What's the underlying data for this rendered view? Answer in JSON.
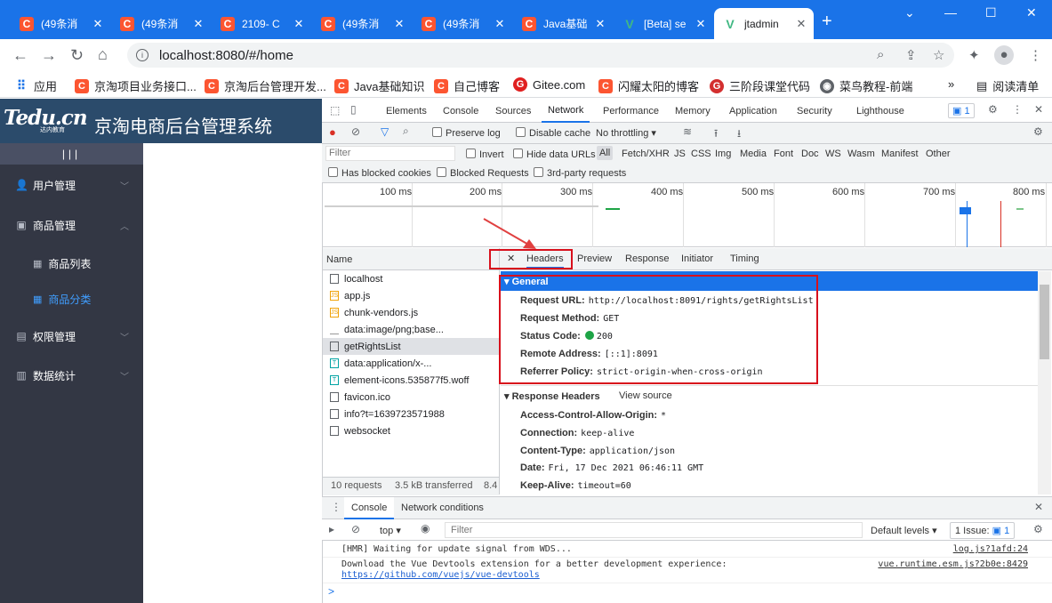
{
  "browser": {
    "tabs": [
      {
        "title": "(49条消",
        "icon": "C"
      },
      {
        "title": "(49条消",
        "icon": "C"
      },
      {
        "title": "2109- C",
        "icon": "C"
      },
      {
        "title": "(49条消",
        "icon": "C"
      },
      {
        "title": "(49条消",
        "icon": "C"
      },
      {
        "title": "Java基础",
        "icon": "C"
      },
      {
        "title": "[Beta] se",
        "icon": "V"
      },
      {
        "title": "jtadmin",
        "icon": "V"
      }
    ],
    "url": "localhost:8080/#/home",
    "bookmarks": [
      {
        "label": "应用"
      },
      {
        "label": "京淘项目业务接口..."
      },
      {
        "label": "京淘后台管理开发..."
      },
      {
        "label": "Java基础知识"
      },
      {
        "label": "自己博客"
      },
      {
        "label": "Gitee.com"
      },
      {
        "label": "闪耀太阳的博客"
      },
      {
        "label": "三阶段课堂代码"
      },
      {
        "label": "菜鸟教程-前端"
      }
    ],
    "reading_list": "阅读清单"
  },
  "app": {
    "logo": "Tedu.cn",
    "logo_sub": "达内教育",
    "title": "京淘电商后台管理系统",
    "toggle": "|||",
    "menu": [
      {
        "label": "用户管理",
        "icon": "user-icon"
      },
      {
        "label": "商品管理",
        "icon": "goods-icon"
      },
      {
        "label": "商品列表",
        "icon": "grid-icon"
      },
      {
        "label": "商品分类",
        "icon": "grid-icon"
      },
      {
        "label": "权限管理",
        "icon": "lock-icon"
      },
      {
        "label": "数据统计",
        "icon": "chart-icon"
      }
    ]
  },
  "devtools": {
    "tabs": [
      "Elements",
      "Console",
      "Sources",
      "Network",
      "Performance",
      "Memory",
      "Application",
      "Security",
      "Lighthouse"
    ],
    "issues_count": "1",
    "preserve_log": "Preserve log",
    "disable_cache": "Disable cache",
    "throttling": "No throttling",
    "filter_placeholder": "Filter",
    "invert": "Invert",
    "hide_data_urls": "Hide data URLs",
    "types": [
      "All",
      "Fetch/XHR",
      "JS",
      "CSS",
      "Img",
      "Media",
      "Font",
      "Doc",
      "WS",
      "Wasm",
      "Manifest",
      "Other"
    ],
    "blocked_cookies": "Has blocked cookies",
    "blocked_requests": "Blocked Requests",
    "third_party": "3rd-party requests",
    "timeline_labels": [
      "100 ms",
      "200 ms",
      "300 ms",
      "400 ms",
      "500 ms",
      "600 ms",
      "700 ms",
      "800 ms"
    ],
    "name_col": "Name",
    "requests": [
      "localhost",
      "app.js",
      "chunk-vendors.js",
      "data:image/png;base...",
      "getRightsList",
      "data:application/x-...",
      "element-icons.535877f5.woff",
      "favicon.ico",
      "info?t=1639723571988",
      "websocket"
    ],
    "summary": {
      "requests": "10 requests",
      "transferred": "3.5 kB transferred",
      "extra": "8.4"
    },
    "detail_tabs": [
      "Headers",
      "Preview",
      "Response",
      "Initiator",
      "Timing"
    ],
    "general": {
      "title": "General",
      "rows": [
        {
          "key": "Request URL:",
          "value": "http://localhost:8091/rights/getRightsList"
        },
        {
          "key": "Request Method:",
          "value": "GET"
        },
        {
          "key": "Status Code:",
          "value": "200"
        },
        {
          "key": "Remote Address:",
          "value": "[::1]:8091"
        },
        {
          "key": "Referrer Policy:",
          "value": "strict-origin-when-cross-origin"
        }
      ]
    },
    "response_headers": {
      "title": "Response Headers",
      "view_source": "View source",
      "rows": [
        {
          "key": "Access-Control-Allow-Origin:",
          "value": "*"
        },
        {
          "key": "Connection:",
          "value": "keep-alive"
        },
        {
          "key": "Content-Type:",
          "value": "application/json"
        },
        {
          "key": "Date:",
          "value": "Fri, 17 Dec 2021 06:46:11 GMT"
        },
        {
          "key": "Keep-Alive:",
          "value": "timeout=60"
        }
      ]
    },
    "drawer": {
      "tabs": [
        "Console",
        "Network conditions"
      ],
      "context": "top",
      "filter_placeholder": "Filter",
      "levels": "Default levels",
      "issue": "1 Issue:",
      "issue_count": "1",
      "messages": [
        {
          "text": "[HMR] Waiting for update signal from WDS...",
          "link": "log.js?1afd:24"
        },
        {
          "text": "Download the Vue Devtools extension for a better development experience:",
          "url": "https://github.com/vuejs/vue-devtools",
          "link": "vue.runtime.esm.js?2b0e:8429"
        }
      ],
      "prompt": ">"
    }
  },
  "colors": {
    "chrome_blue": "#1a73e8",
    "sidebar": "#333744",
    "header": "#2b4b6b",
    "active_menu": "#409eff",
    "highlight_box": "#d8101c",
    "status_ok": "#1ea446"
  }
}
